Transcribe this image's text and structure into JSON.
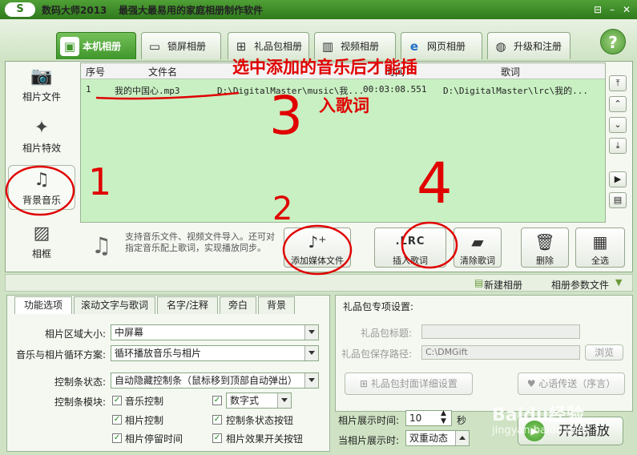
{
  "app": {
    "logo": "S",
    "title": "数码大师2013",
    "slogan": "最强大最易用的家庭相册制作软件"
  },
  "window_controls": [
    "⊟",
    "–",
    "✕"
  ],
  "tabs": [
    {
      "label": "本机相册",
      "icon": "portrait-icon",
      "active": true
    },
    {
      "label": "锁屏相册",
      "icon": "monitor-icon"
    },
    {
      "label": "礼品包相册",
      "icon": "gift-icon"
    },
    {
      "label": "视频相册",
      "icon": "film-icon"
    },
    {
      "label": "网页相册",
      "icon": "ie-icon"
    },
    {
      "label": "升级和注册",
      "icon": "globe-icon"
    }
  ],
  "help_label": "?",
  "sidebar": [
    {
      "label": "相片文件",
      "icon": "camera-icon"
    },
    {
      "label": "相片特效",
      "icon": "effects-icon"
    },
    {
      "label": "背景音乐",
      "icon": "music-note-icon",
      "active": true
    },
    {
      "label": "相框",
      "icon": "picture-frame-icon"
    }
  ],
  "table": {
    "columns": [
      "序号",
      "文件名",
      "",
      "时间",
      "歌词"
    ],
    "rows": [
      {
        "index": "1",
        "filename": "我的中国心.mp3",
        "path": "D:\\DigitalMaster\\music\\我...",
        "time": "00:03:08.551",
        "lyrics": "D:\\DigitalMaster\\lrc\\我的..."
      }
    ]
  },
  "right_controls": [
    "⤒",
    "⌃",
    "⌄",
    "⤓",
    "▶",
    "▤"
  ],
  "action": {
    "description": "支持音乐文件、视频文件导入。还可对指定音乐配上歌词，实现播放同步。",
    "buttons": [
      {
        "label": "添加媒体文件",
        "icon": "add-music-icon",
        "glyph": "♪⁺"
      },
      {
        "label": "插入歌词",
        "icon": "lrc-icon",
        "glyph": ".LRC"
      },
      {
        "label": "清除歌词",
        "icon": "eraser-icon",
        "glyph": "▰"
      },
      {
        "label": "删除",
        "icon": "trash-icon",
        "glyph": "🗑"
      },
      {
        "label": "全选",
        "icon": "select-all-icon",
        "glyph": "▦"
      }
    ]
  },
  "albumbar": {
    "new_album": "新建相册",
    "album_params": "相册参数文件"
  },
  "subtabs": [
    "功能选项",
    "滚动文字与歌词",
    "名字/注释",
    "旁白",
    "背景"
  ],
  "options": {
    "photo_area_label": "相片区域大小:",
    "photo_area_value": "中屏幕",
    "loop_label": "音乐与相片循环方案:",
    "loop_value": "循环播放音乐与相片",
    "control_state_label": "控制条状态:",
    "control_state_value": "自动隐藏控制条（鼠标移到顶部自动弹出）",
    "control_module_label": "控制条模块:",
    "checks": [
      {
        "label": "音乐控制",
        "checked": true
      },
      {
        "label": "数字式",
        "checked": true,
        "select": true
      },
      {
        "label": "相片控制",
        "checked": true
      },
      {
        "label": "控制条状态按钮",
        "checked": true
      },
      {
        "label": "相片停留时间",
        "checked": true
      },
      {
        "label": "相片效果开关按钮",
        "checked": true
      }
    ]
  },
  "gift": {
    "header": "礼品包专项设置:",
    "title_label": "礼品包标题:",
    "title_value": "",
    "path_label": "礼品包保存路径:",
    "path_value": "C:\\DMGift",
    "browse": "浏览",
    "cover_button": "礼品包封面详细设置",
    "mood_button": "心语传送（序言）"
  },
  "timing": {
    "show_time_label": "相片展示时间:",
    "show_time_value": "10",
    "unit": "秒",
    "effect_label": "当相片展示时:",
    "effect_value": "双重动态"
  },
  "play_button": "开始播放",
  "annotations": {
    "instruction_line1": "选中添加的音乐后才能插",
    "instruction_line2": "入歌词",
    "n1": "1",
    "n2": "2",
    "n3": "3",
    "n4": "4"
  },
  "watermark": {
    "line1": "Baidu经验",
    "line2": "jingyan.baidu.com"
  },
  "colors": {
    "accent_green": "#3f962a",
    "list_bg": "#c9f0c3",
    "annotation_red": "#e00000"
  }
}
